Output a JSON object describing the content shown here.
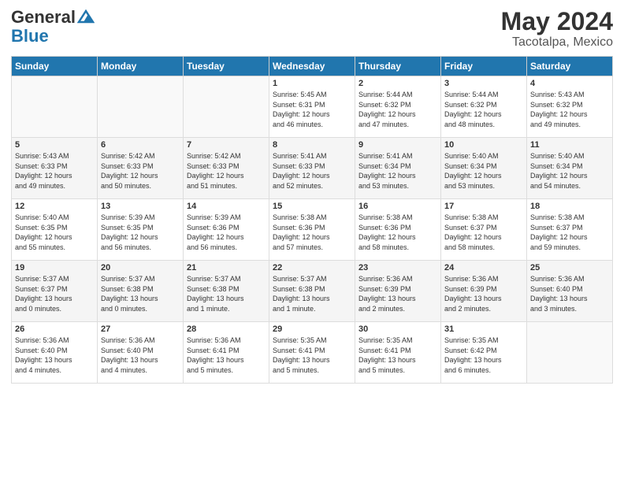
{
  "logo": {
    "line1": "General",
    "line2": "Blue"
  },
  "title": "May 2024",
  "location": "Tacotalpa, Mexico",
  "days_header": [
    "Sunday",
    "Monday",
    "Tuesday",
    "Wednesday",
    "Thursday",
    "Friday",
    "Saturday"
  ],
  "weeks": [
    [
      {
        "day": "",
        "info": ""
      },
      {
        "day": "",
        "info": ""
      },
      {
        "day": "",
        "info": ""
      },
      {
        "day": "1",
        "info": "Sunrise: 5:45 AM\nSunset: 6:31 PM\nDaylight: 12 hours\nand 46 minutes."
      },
      {
        "day": "2",
        "info": "Sunrise: 5:44 AM\nSunset: 6:32 PM\nDaylight: 12 hours\nand 47 minutes."
      },
      {
        "day": "3",
        "info": "Sunrise: 5:44 AM\nSunset: 6:32 PM\nDaylight: 12 hours\nand 48 minutes."
      },
      {
        "day": "4",
        "info": "Sunrise: 5:43 AM\nSunset: 6:32 PM\nDaylight: 12 hours\nand 49 minutes."
      }
    ],
    [
      {
        "day": "5",
        "info": "Sunrise: 5:43 AM\nSunset: 6:33 PM\nDaylight: 12 hours\nand 49 minutes."
      },
      {
        "day": "6",
        "info": "Sunrise: 5:42 AM\nSunset: 6:33 PM\nDaylight: 12 hours\nand 50 minutes."
      },
      {
        "day": "7",
        "info": "Sunrise: 5:42 AM\nSunset: 6:33 PM\nDaylight: 12 hours\nand 51 minutes."
      },
      {
        "day": "8",
        "info": "Sunrise: 5:41 AM\nSunset: 6:33 PM\nDaylight: 12 hours\nand 52 minutes."
      },
      {
        "day": "9",
        "info": "Sunrise: 5:41 AM\nSunset: 6:34 PM\nDaylight: 12 hours\nand 53 minutes."
      },
      {
        "day": "10",
        "info": "Sunrise: 5:40 AM\nSunset: 6:34 PM\nDaylight: 12 hours\nand 53 minutes."
      },
      {
        "day": "11",
        "info": "Sunrise: 5:40 AM\nSunset: 6:34 PM\nDaylight: 12 hours\nand 54 minutes."
      }
    ],
    [
      {
        "day": "12",
        "info": "Sunrise: 5:40 AM\nSunset: 6:35 PM\nDaylight: 12 hours\nand 55 minutes."
      },
      {
        "day": "13",
        "info": "Sunrise: 5:39 AM\nSunset: 6:35 PM\nDaylight: 12 hours\nand 56 minutes."
      },
      {
        "day": "14",
        "info": "Sunrise: 5:39 AM\nSunset: 6:36 PM\nDaylight: 12 hours\nand 56 minutes."
      },
      {
        "day": "15",
        "info": "Sunrise: 5:38 AM\nSunset: 6:36 PM\nDaylight: 12 hours\nand 57 minutes."
      },
      {
        "day": "16",
        "info": "Sunrise: 5:38 AM\nSunset: 6:36 PM\nDaylight: 12 hours\nand 58 minutes."
      },
      {
        "day": "17",
        "info": "Sunrise: 5:38 AM\nSunset: 6:37 PM\nDaylight: 12 hours\nand 58 minutes."
      },
      {
        "day": "18",
        "info": "Sunrise: 5:38 AM\nSunset: 6:37 PM\nDaylight: 12 hours\nand 59 minutes."
      }
    ],
    [
      {
        "day": "19",
        "info": "Sunrise: 5:37 AM\nSunset: 6:37 PM\nDaylight: 13 hours\nand 0 minutes."
      },
      {
        "day": "20",
        "info": "Sunrise: 5:37 AM\nSunset: 6:38 PM\nDaylight: 13 hours\nand 0 minutes."
      },
      {
        "day": "21",
        "info": "Sunrise: 5:37 AM\nSunset: 6:38 PM\nDaylight: 13 hours\nand 1 minute."
      },
      {
        "day": "22",
        "info": "Sunrise: 5:37 AM\nSunset: 6:38 PM\nDaylight: 13 hours\nand 1 minute."
      },
      {
        "day": "23",
        "info": "Sunrise: 5:36 AM\nSunset: 6:39 PM\nDaylight: 13 hours\nand 2 minutes."
      },
      {
        "day": "24",
        "info": "Sunrise: 5:36 AM\nSunset: 6:39 PM\nDaylight: 13 hours\nand 2 minutes."
      },
      {
        "day": "25",
        "info": "Sunrise: 5:36 AM\nSunset: 6:40 PM\nDaylight: 13 hours\nand 3 minutes."
      }
    ],
    [
      {
        "day": "26",
        "info": "Sunrise: 5:36 AM\nSunset: 6:40 PM\nDaylight: 13 hours\nand 4 minutes."
      },
      {
        "day": "27",
        "info": "Sunrise: 5:36 AM\nSunset: 6:40 PM\nDaylight: 13 hours\nand 4 minutes."
      },
      {
        "day": "28",
        "info": "Sunrise: 5:36 AM\nSunset: 6:41 PM\nDaylight: 13 hours\nand 5 minutes."
      },
      {
        "day": "29",
        "info": "Sunrise: 5:35 AM\nSunset: 6:41 PM\nDaylight: 13 hours\nand 5 minutes."
      },
      {
        "day": "30",
        "info": "Sunrise: 5:35 AM\nSunset: 6:41 PM\nDaylight: 13 hours\nand 5 minutes."
      },
      {
        "day": "31",
        "info": "Sunrise: 5:35 AM\nSunset: 6:42 PM\nDaylight: 13 hours\nand 6 minutes."
      },
      {
        "day": "",
        "info": ""
      }
    ]
  ]
}
